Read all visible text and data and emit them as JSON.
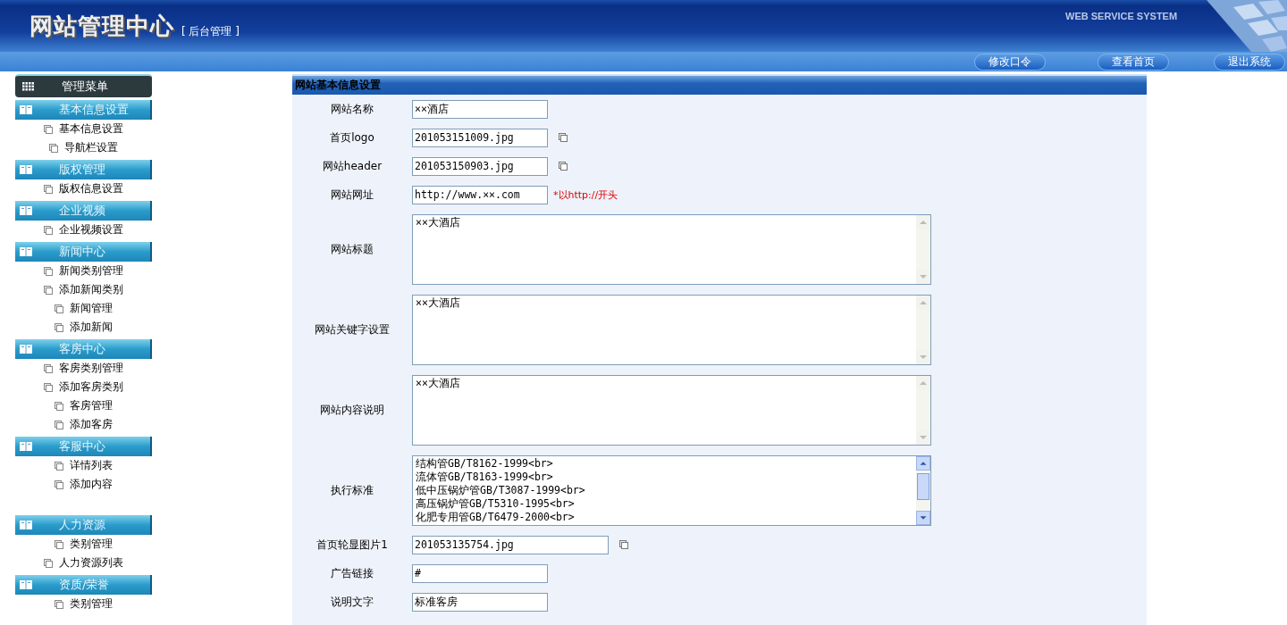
{
  "header": {
    "title": "网站管理中心",
    "subtitle": "[ 后台管理 ]",
    "tagline": "WEB SERVICE SYSTEM",
    "buttons": [
      "修改口令",
      "查看首页",
      "退出系统"
    ]
  },
  "sidebar": {
    "title": "管理菜单",
    "groups": [
      {
        "label": "基本信息设置",
        "items": [
          "基本信息设置",
          "导航栏设置"
        ]
      },
      {
        "label": "版权管理",
        "items": [
          "版权信息设置"
        ]
      },
      {
        "label": "企业视频",
        "items": [
          "企业视频设置"
        ]
      },
      {
        "label": "新闻中心",
        "items": [
          "新闻类别管理",
          "添加新闻类别",
          "新闻管理",
          "添加新闻"
        ]
      },
      {
        "label": "客房中心",
        "items": [
          "客房类别管理",
          "添加客房类别",
          "客房管理",
          "添加客房"
        ]
      },
      {
        "label": "客服中心",
        "items": [
          "详情列表",
          "添加内容"
        ]
      },
      {
        "label": "人力资源",
        "items": [
          "类别管理",
          "人力资源列表"
        ]
      },
      {
        "label": "资质/荣誉",
        "items": [
          "类别管理"
        ]
      }
    ]
  },
  "panel": {
    "title": "网站基本信息设置",
    "fields": [
      {
        "kind": "text",
        "label": "网站名称",
        "value": "××酒店"
      },
      {
        "kind": "upload",
        "label": "首页logo",
        "value": "201053151009.jpg"
      },
      {
        "kind": "upload",
        "label": "网站header",
        "value": "201053150903.jpg"
      },
      {
        "kind": "text",
        "label": "网站网址",
        "value": "http://www.××.com",
        "hint": "*以http://开头"
      },
      {
        "kind": "textarea",
        "label": "网站标题",
        "lines": [
          "××大酒店"
        ],
        "scrollable": false
      },
      {
        "kind": "textarea",
        "label": "网站关键字设置",
        "lines": [
          "××大酒店"
        ],
        "scrollable": false
      },
      {
        "kind": "textarea",
        "label": "网站内容说明",
        "lines": [
          "××大酒店"
        ],
        "scrollable": false
      },
      {
        "kind": "textarea",
        "label": "执行标准",
        "lines": [
          "结构管GB/T8162-1999<br>",
          "流体管GB/T8163-1999<br>",
          "低中压锅炉管GB/T3087-1999<br>",
          "高压锅炉管GB/T5310-1995<br>",
          "化肥专用管GB/T6479-2000<br>"
        ],
        "scrollable": true
      },
      {
        "kind": "wide-upload",
        "label": "首页轮显图片1",
        "value": "201053135754.jpg"
      },
      {
        "kind": "text",
        "label": "广告链接",
        "value": "#"
      },
      {
        "kind": "text",
        "label": "说明文字",
        "value": "标准客房"
      }
    ]
  }
}
